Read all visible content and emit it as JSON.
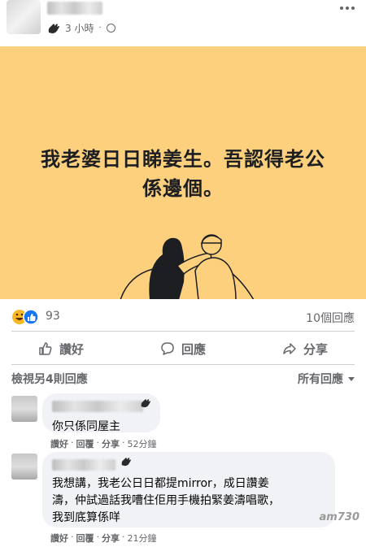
{
  "post": {
    "time": "3 小時",
    "separator": "·",
    "text_line1": "我老婆日日睇姜生。吾認得老公",
    "text_line2": "係邊個。",
    "background_color": "#fdd07e"
  },
  "stats": {
    "reaction_count": "93",
    "comment_count": "10個回應"
  },
  "actions": {
    "like": "讚好",
    "comment": "回應",
    "share": "分享"
  },
  "comments_header": {
    "view_more": "檢視另4則回應",
    "sort": "所有回應"
  },
  "comments": [
    {
      "text": "你只係同屋主",
      "like": "讚好",
      "reply": "回覆",
      "share": "分享",
      "time": "52分鐘"
    },
    {
      "text_line1": "我想講，我老公日日都提mirror，成日讚姜",
      "text_line2": "濤，仲試過話我嘈住佢用手機拍緊姜濤唱歌，",
      "text_line3": "我到底算係咩",
      "like": "讚好",
      "reply": "回覆",
      "share": "分享",
      "time": "21分鐘"
    }
  ],
  "watermark": "am730"
}
